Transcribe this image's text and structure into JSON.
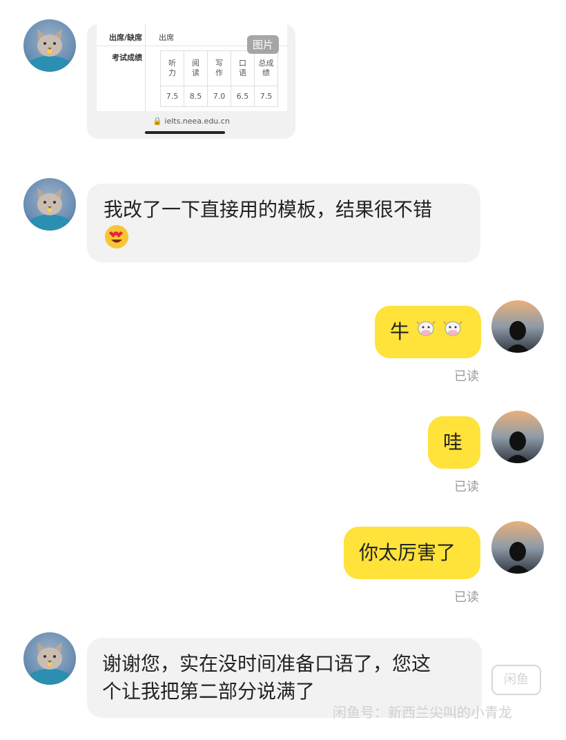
{
  "screenshot_card": {
    "attendance_label": "出席/缺席",
    "attendance_value": "出席",
    "scores_label": "考试成绩",
    "headers": [
      "听\n力",
      "阅\n读",
      "写\n作",
      "口\n语",
      "总成\n绩"
    ],
    "values": [
      "7.5",
      "8.5",
      "7.0",
      "6.5",
      "7.5"
    ],
    "image_tag": "图片",
    "url": "ielts.neea.edu.cn"
  },
  "messages": [
    {
      "side": "in",
      "text": "我改了一下直接用的模板，结果很不错",
      "emoji": "heart-eyes-icon"
    },
    {
      "side": "out",
      "text": "牛",
      "emoji": "cow-face-icon",
      "status": "已读"
    },
    {
      "side": "out",
      "text": "哇",
      "status": "已读"
    },
    {
      "side": "out",
      "text": "你太厉害了",
      "status": "已读"
    },
    {
      "side": "in",
      "text_line1": "谢谢您，实在没时间准备口语了，您这",
      "text_line2": "个让我把第二部分说满了"
    }
  ],
  "watermark": {
    "logo": "闲鱼",
    "text": "闲鱼号：新西兰尖叫的小青龙"
  },
  "colors": {
    "out_bubble": "#ffe23a",
    "in_bubble": "#f2f2f3",
    "read_status": "#9a9a9a"
  }
}
